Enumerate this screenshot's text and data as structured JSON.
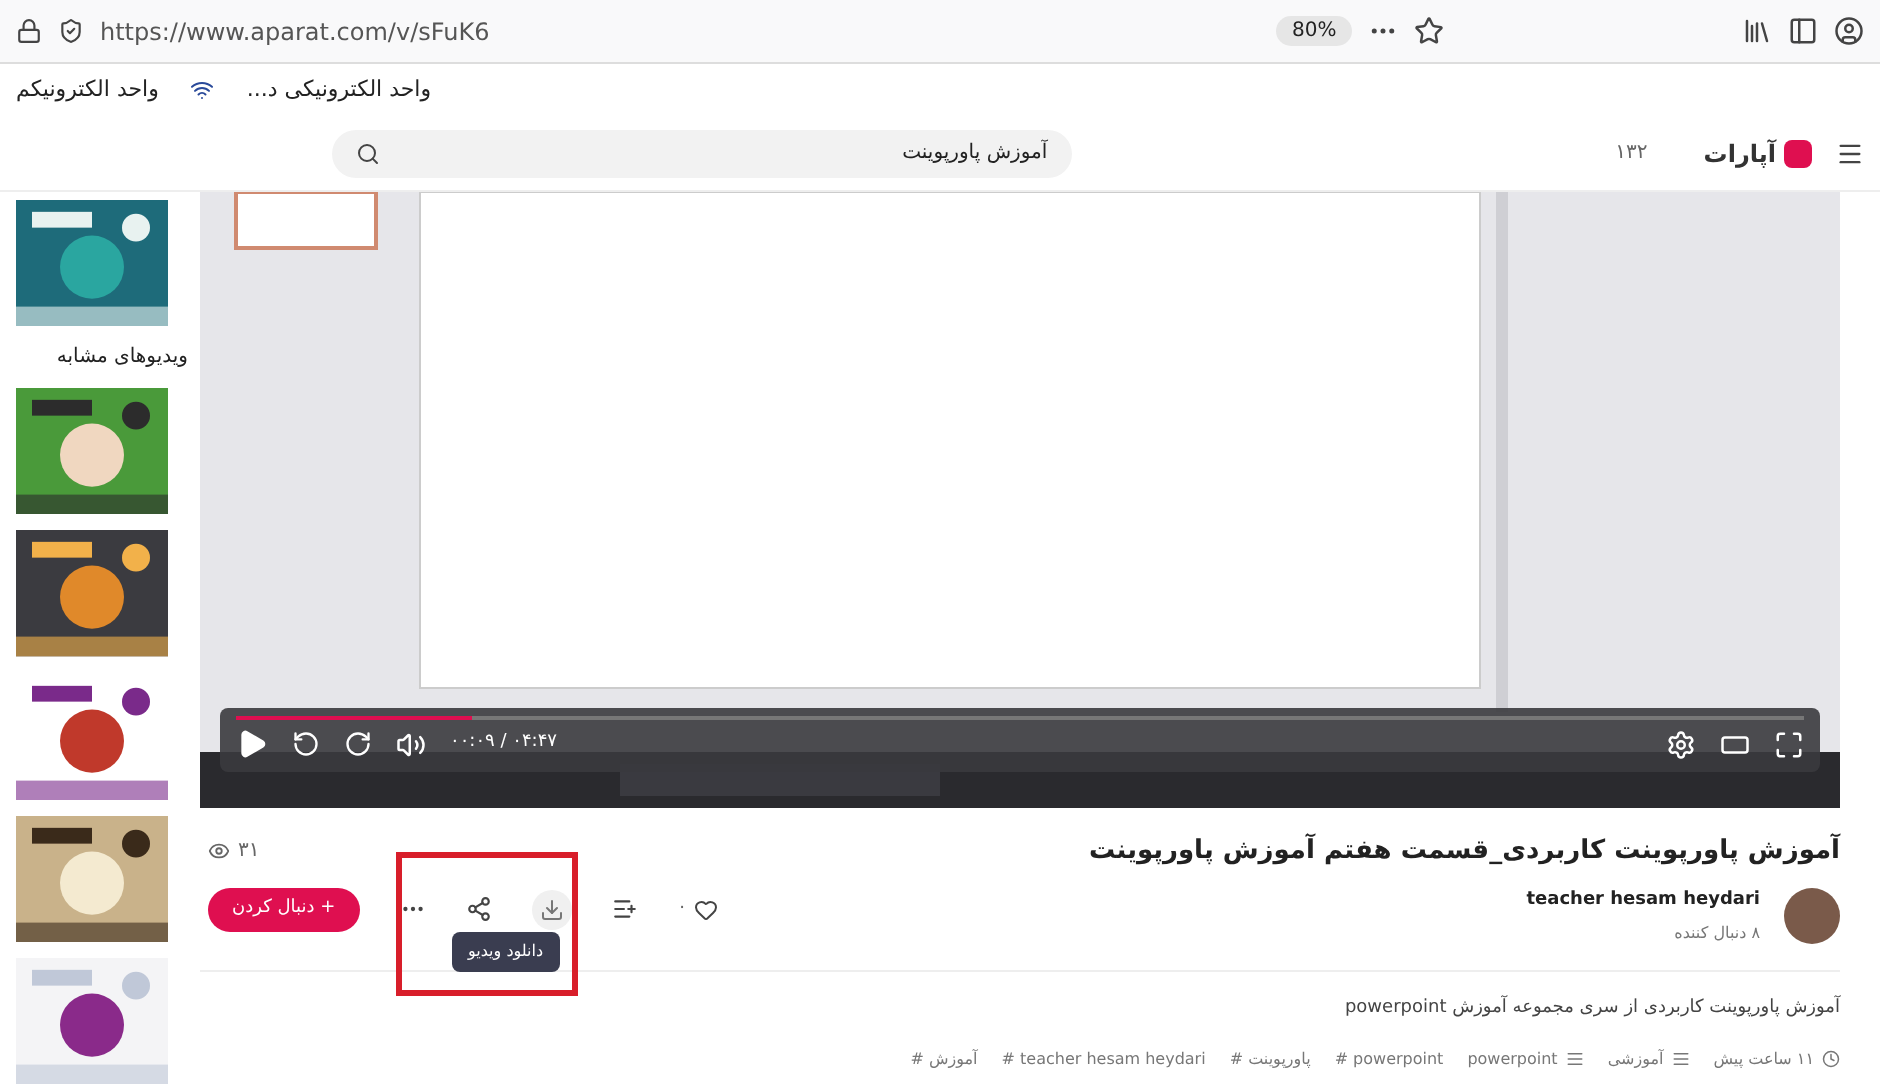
{
  "browser": {
    "url": "https://www.aparat.com/v/sFuK6",
    "zoom": "80%"
  },
  "bookmarks": [
    "واحد الکترونیکی د...",
    "واحد الکترونیکم"
  ],
  "header": {
    "logo": "آپارات",
    "count": "۱۳۲",
    "search": {
      "value": "آموزش پاورپوینت"
    }
  },
  "sidebar": {
    "heading": "ویدیوهای مشابه"
  },
  "player": {
    "time": "۰۰:۰۹ / ۰۴:۴۷",
    "level": 0.15
  },
  "video": {
    "title": "آموزش پاورپوینت کاربردی_قسمت هفتم آموزش پاورپوینت",
    "views": "۳۱",
    "likes": "۰",
    "follow_button": "+ دنبال کردن",
    "tooltip": "دانلود ویدیو",
    "channel": {
      "name": "teacher hesam heydari",
      "followers": "۸ دنبال کننده"
    },
    "description": "آموزش پاورپوینت کاربردی از سری مجموعه آموزش powerpoint",
    "published": "۱۱ ساعت پیش",
    "categories": [
      "آموزشی",
      "powerpoint"
    ],
    "tags": [
      "# powerpoint",
      "# پاورپوینت",
      "# teacher hesam heydari",
      "# آموزش"
    ]
  }
}
